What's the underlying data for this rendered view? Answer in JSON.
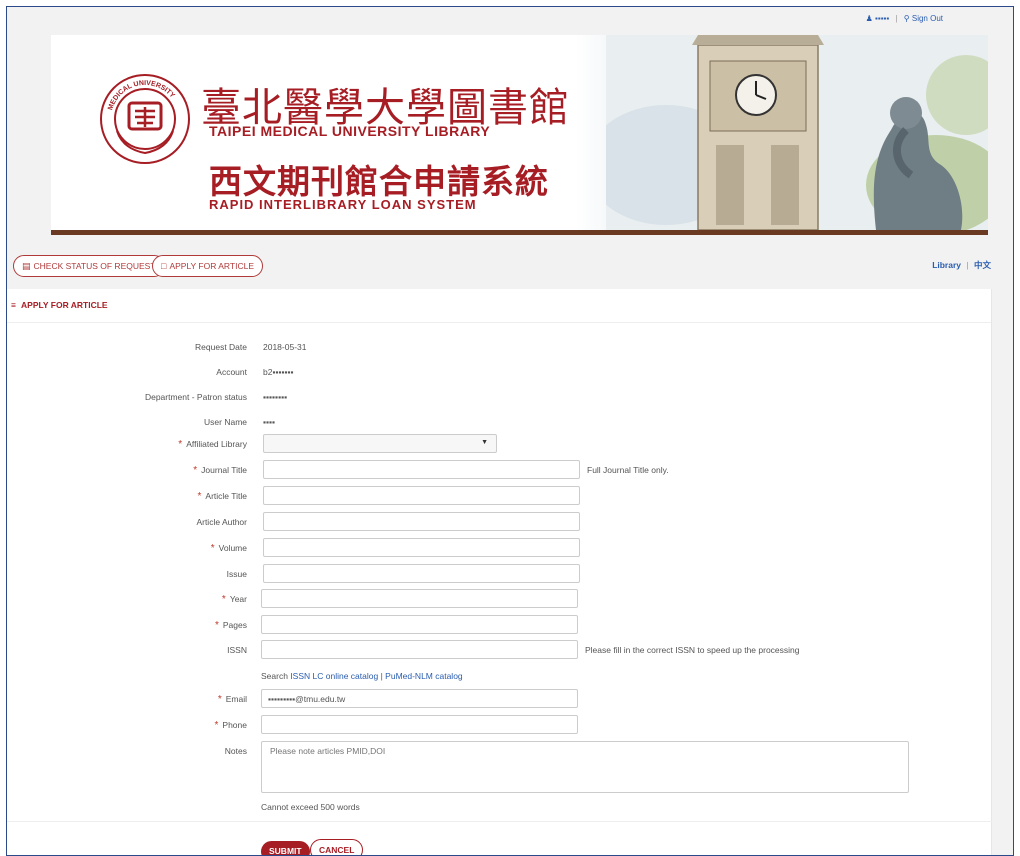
{
  "header": {
    "user_name": "▪▪▪▪▪",
    "separator": "|",
    "sign_out": "Sign Out",
    "user_icon": "user-icon",
    "sign_out_icon": "key-icon"
  },
  "banner": {
    "seal_text": "MEDICAL UNIVERSITY",
    "title_zh": "臺北醫學大學圖書館",
    "title_en": "TAIPEI MEDICAL UNIVERSITY LIBRARY",
    "system_zh": "西文期刊館合申請系統",
    "system_en": "RAPID INTERLIBRARY LOAN SYSTEM",
    "accent_color": "#a61d24"
  },
  "nav": {
    "check_status": "CHECK STATUS OF REQUEST",
    "apply": "APPLY FOR ARTICLE",
    "library_link": "Library",
    "lang_sep": "|",
    "lang_link": "中文"
  },
  "panel": {
    "title": "APPLY FOR ARTICLE",
    "fields": {
      "request_date": {
        "label": "Request Date",
        "value": "2018-05-31"
      },
      "account": {
        "label": "Account",
        "value": "b2▪▪▪▪▪▪▪"
      },
      "department": {
        "label": "Department - Patron status",
        "value": "▪▪▪▪▪▪▪▪"
      },
      "user_name": {
        "label": "User Name",
        "value": "▪▪▪▪"
      },
      "affiliated_library": {
        "label": "Affiliated Library",
        "value": ""
      },
      "journal_title": {
        "label": "Journal Title",
        "value": "",
        "hint": "Full Journal Title only."
      },
      "article_title": {
        "label": "Article Title",
        "value": ""
      },
      "article_author": {
        "label": "Article Author",
        "value": ""
      },
      "volume": {
        "label": "Volume",
        "value": ""
      },
      "issue": {
        "label": "Issue",
        "value": ""
      },
      "year": {
        "label": "Year",
        "value": ""
      },
      "pages": {
        "label": "Pages",
        "value": ""
      },
      "issn": {
        "label": "ISSN",
        "value": "",
        "hint": "Please fill in the correct ISSN to speed up the processing"
      },
      "email": {
        "label": "Email",
        "value": "▪▪▪▪▪▪▪▪▪@tmu.edu.tw"
      },
      "phone": {
        "label": "Phone",
        "value": ""
      },
      "notes": {
        "label": "Notes",
        "placeholder": "Please note articles PMID,DOI",
        "hint": "Cannot exceed 500 words"
      }
    },
    "search": {
      "prefix": "Search",
      "issn_link": "ISSN LC online catalog",
      "sep": "|",
      "pubmed_link": "PuMed-NLM catalog"
    },
    "required_mark": "*",
    "submit": "SUBMIT",
    "cancel": "CANCEL"
  }
}
